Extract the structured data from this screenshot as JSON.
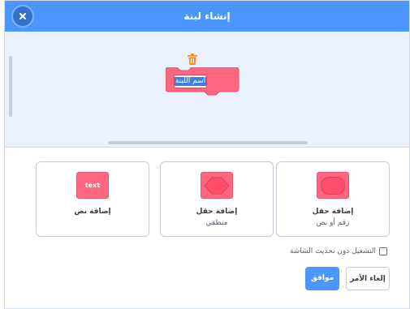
{
  "dialog": {
    "title": "إنشاء لبنة"
  },
  "block": {
    "name_value": "اسم اللبنة",
    "color": "#ff6680"
  },
  "options": [
    {
      "label": "إضافة حقل",
      "sublabel": "رقم أو نص",
      "icon": "round-input-icon"
    },
    {
      "label": "إضافة حقل",
      "sublabel": "منطقي",
      "icon": "boolean-input-icon"
    },
    {
      "label": "إضافة نص",
      "sublabel": "",
      "icon_text": "text",
      "icon": "text-label-icon"
    }
  ],
  "run_without_refresh": {
    "label": "التشغيل دون تحديث الشاشة",
    "checked": false
  },
  "buttons": {
    "ok": "موافق",
    "cancel": "إلغاء الأمر"
  },
  "colors": {
    "accent": "#4c97ff",
    "block": "#ff6680",
    "preview_bg": "#e9f1fc"
  }
}
